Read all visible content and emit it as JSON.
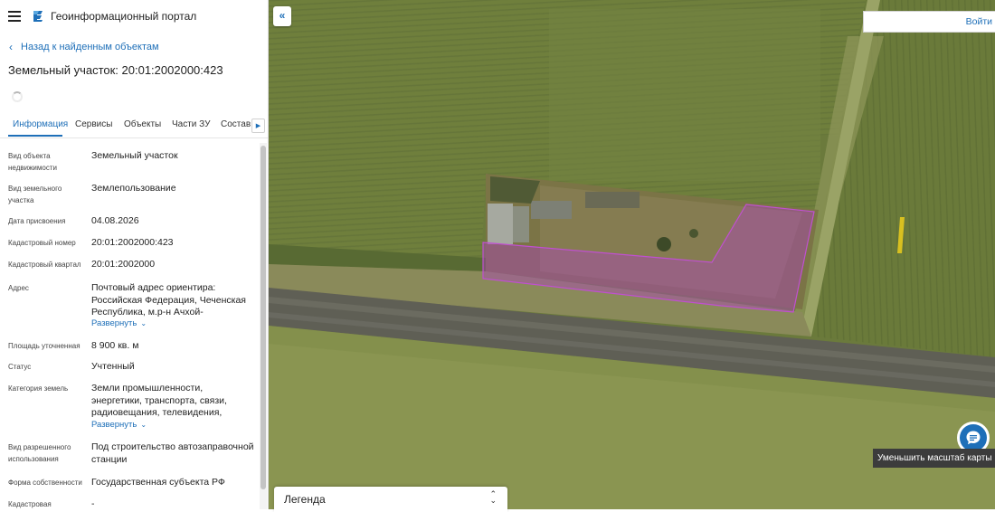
{
  "app": {
    "title": "Геоинформационный портал"
  },
  "nav": {
    "back_label": "Назад к найденным объектам"
  },
  "object": {
    "title": "Земельный участок: 20:01:2002000:423"
  },
  "tabs": [
    "Информация",
    "Сервисы",
    "Объекты",
    "Части ЗУ",
    "Состав"
  ],
  "fields": [
    {
      "label": "Вид объекта недвижимости",
      "value": "Земельный участок"
    },
    {
      "label": "Вид земельного участка",
      "value": "Землепользование"
    },
    {
      "label": "Дата присвоения",
      "value": "04.08.2026"
    },
    {
      "label": "Кадастровый номер",
      "value": "20:01:2002000:423"
    },
    {
      "label": "Кадастровый квартал",
      "value": "20:01:2002000"
    },
    {
      "label": "Адрес",
      "value": "Почтовый адрес ориентира: Российская Федерация, Чеченская Республика, м.р-н Ачхой-",
      "expand": "Развернуть"
    },
    {
      "label": "Площадь уточненная",
      "value": "8 900 кв. м"
    },
    {
      "label": "Статус",
      "value": "Учтенный"
    },
    {
      "label": "Категория земель",
      "value": "Земли промышленности, энергетики, транспорта, связи, радиовещания, телевидения,",
      "expand": "Развернуть"
    },
    {
      "label": "Вид разрешенного использования",
      "value": "Под строительство автозаправочной станции"
    },
    {
      "label": "Форма собственности",
      "value": "Государственная субъекта РФ"
    },
    {
      "label": "Кадастровая",
      "value": "-"
    }
  ],
  "map": {
    "login_label": "Войти",
    "legend_label": "Легенда",
    "zoom_out_tooltip": "Уменьшить масштаб карты"
  },
  "colors": {
    "accent": "#1e6fb8",
    "parcel": "#b040c0"
  },
  "icons": {
    "menu": "hamburger-icon",
    "logo": "logo-icon",
    "collapse": "double-chevron-left-icon",
    "chat": "chat-icon"
  }
}
